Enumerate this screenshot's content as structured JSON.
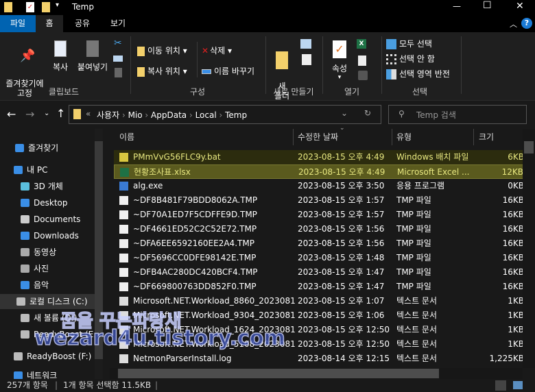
{
  "window": {
    "title": "Temp",
    "minimize": "—",
    "maximize": "☐",
    "close": "✕"
  },
  "tabs": [
    {
      "label": "파일"
    },
    {
      "label": "홈"
    },
    {
      "label": "공유"
    },
    {
      "label": "보기"
    }
  ],
  "ribbon": {
    "clipboard": {
      "group": "클립보드",
      "pin": "즐겨찾기에\n고정",
      "copy": "복사",
      "paste": "붙여넣기"
    },
    "organize": {
      "group": "구성",
      "move_to": "이동 위치",
      "copy_to": "복사 위치",
      "delete": "삭제",
      "rename": "이름 바꾸기"
    },
    "new": {
      "group": "새로 만들기",
      "new_folder": "새\n폴더"
    },
    "open": {
      "group": "열기",
      "properties": "속성"
    },
    "select": {
      "group": "선택",
      "select_all": "모두 선택",
      "select_none": "선택 안 함",
      "invert": "선택 영역 반전"
    }
  },
  "address": {
    "prefix": "«",
    "crumbs": [
      "사용자",
      "Mio",
      "AppData",
      "Local",
      "Temp"
    ]
  },
  "search": {
    "placeholder": "Temp 검색"
  },
  "nav": [
    {
      "label": "즐겨찾기",
      "icon": "star-icon"
    },
    {
      "label": "내 PC",
      "icon": "pc-icon"
    },
    {
      "label": "3D 개체",
      "icon": "cube-icon"
    },
    {
      "label": "Desktop",
      "icon": "desktop-icon"
    },
    {
      "label": "Documents",
      "icon": "documents-icon"
    },
    {
      "label": "Downloads",
      "icon": "downloads-icon"
    },
    {
      "label": "동영상",
      "icon": "video-icon"
    },
    {
      "label": "사진",
      "icon": "pictures-icon"
    },
    {
      "label": "음악",
      "icon": "music-icon"
    },
    {
      "label": "로컬 디스크 (C:)",
      "icon": "drive-icon"
    },
    {
      "label": "새 볼륨 (D:)",
      "icon": "drive-icon"
    },
    {
      "label": "ReadyBoost (E:)",
      "icon": "drive-icon"
    },
    {
      "label": "ReadyBoost (F:)",
      "icon": "drive-icon"
    },
    {
      "label": "네트워크",
      "icon": "network-icon"
    }
  ],
  "columns": {
    "name": "이름",
    "date": "수정한 날짜",
    "type": "유형",
    "size": "크기"
  },
  "files": [
    {
      "name": "PMmVvG56FLC9y.bat",
      "date": "2023-08-15 오후 4:49",
      "type": "Windows 배치 파일",
      "size": "6KB",
      "icon": "bat",
      "state": "hover"
    },
    {
      "name": "현황조사표.xlsx",
      "date": "2023-08-15 오후 4:49",
      "type": "Microsoft Excel ...",
      "size": "12KB",
      "icon": "xlsx",
      "state": "selected"
    },
    {
      "name": "alg.exe",
      "date": "2023-08-15 오후 3:50",
      "type": "응용 프로그램",
      "size": "0KB",
      "icon": "exe"
    },
    {
      "name": "~DF8B481F79BDD8062A.TMP",
      "date": "2023-08-15 오후 1:57",
      "type": "TMP 파일",
      "size": "16KB",
      "icon": "file"
    },
    {
      "name": "~DF70A1ED7F5CDFFE9D.TMP",
      "date": "2023-08-15 오후 1:57",
      "type": "TMP 파일",
      "size": "16KB",
      "icon": "file"
    },
    {
      "name": "~DF4661ED52C2C52E72.TMP",
      "date": "2023-08-15 오후 1:56",
      "type": "TMP 파일",
      "size": "16KB",
      "icon": "file"
    },
    {
      "name": "~DFA6EE6592160EE2A4.TMP",
      "date": "2023-08-15 오후 1:56",
      "type": "TMP 파일",
      "size": "16KB",
      "icon": "file"
    },
    {
      "name": "~DF5696CC0DFE98142E.TMP",
      "date": "2023-08-15 오후 1:48",
      "type": "TMP 파일",
      "size": "16KB",
      "icon": "file"
    },
    {
      "name": "~DFB4AC280DC420BCF4.TMP",
      "date": "2023-08-15 오후 1:47",
      "type": "TMP 파일",
      "size": "16KB",
      "icon": "file"
    },
    {
      "name": "~DF669800763DD852F0.TMP",
      "date": "2023-08-15 오후 1:47",
      "type": "TMP 파일",
      "size": "16KB",
      "icon": "file"
    },
    {
      "name": "Microsoft.NET.Workload_8860_2023081...",
      "date": "2023-08-15 오후 1:07",
      "type": "텍스트 문서",
      "size": "1KB",
      "icon": "text"
    },
    {
      "name": "Microsoft.NET.Workload_9304_2023081...",
      "date": "2023-08-15 오후 1:06",
      "type": "텍스트 문서",
      "size": "1KB",
      "icon": "text"
    },
    {
      "name": "Microsoft.NET.Workload_1624_2023081...",
      "date": "2023-08-15 오후 12:50",
      "type": "텍스트 문서",
      "size": "1KB",
      "icon": "text"
    },
    {
      "name": "Microsoft.NET.Workload_5108_2023081...",
      "date": "2023-08-15 오후 12:50",
      "type": "텍스트 문서",
      "size": "1KB",
      "icon": "text"
    },
    {
      "name": "NetmonParserInstall.log",
      "date": "2023-08-14 오후 12:15",
      "type": "텍스트 문서",
      "size": "1,225KB",
      "icon": "text"
    }
  ],
  "status": {
    "count": "257개 항목",
    "selection": "1개 항목 선택함 11.5KB"
  },
  "watermark": {
    "line1": "꿈을 꾸는파랑새",
    "line2": "wezard4u.tistory.com"
  },
  "colors": {
    "accent": "#0063b1",
    "hover": "#2c2c0e",
    "selected": "#5a5a1e",
    "selected_text": "#e8e880"
  }
}
